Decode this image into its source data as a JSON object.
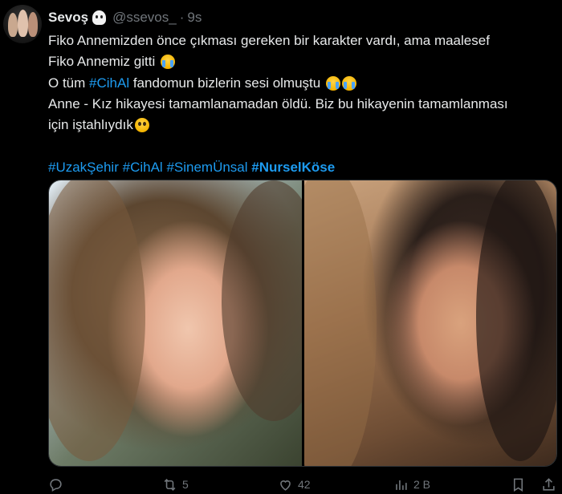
{
  "author": {
    "display_name": "Sevoş",
    "handle": "@ssevos_",
    "separator": "·",
    "time": "9s",
    "avatar_icon": "avatar",
    "badge_icon": "ghost-emoji-icon"
  },
  "tweet": {
    "lines": [
      {
        "a": "Fiko Annemizden önce çıkması gereken bir karakter vardı,  ama maalesef"
      },
      {
        "a": "Fiko Annemiz gitti",
        "emoji": "loudly-crying-face-icon"
      },
      {
        "a": "O tüm ",
        "tag": "#CihAl",
        "b": " fandomun bizlerin sesi olmuştu",
        "emoji": "loudly-crying-face-icon"
      },
      {
        "a": "Anne - Kız hikayesi tamamlanamadan öldü. Biz bu hikayenin tamamlanması"
      },
      {
        "a": "için iştahlıydık",
        "emoji": "pleading-face-icon"
      }
    ],
    "line1": "Fiko Annemizden önce çıkması gereken bir karakter vardı,  ama maalesef",
    "line2": "Fiko Annemiz gitti",
    "line3_pre": "O tüm ",
    "line3_tag": "#CihAl",
    "line3_post": " fandomun bizlerin sesi olmuştu",
    "line4": "Anne - Kız hikayesi tamamlanamadan öldü. Biz bu hikayenin tamamlanması",
    "line5": "için iştahlıydık",
    "hashtags": [
      "#UzakŞehir",
      "#CihAl",
      "#SinemÜnsal",
      "#NurselKöse"
    ]
  },
  "media": [
    {
      "name": "photo-young-woman-crying"
    },
    {
      "name": "photo-older-woman-injured"
    }
  ],
  "actions": {
    "reply": {
      "icon": "reply-icon",
      "count": ""
    },
    "retweet": {
      "icon": "retweet-icon",
      "count": "5"
    },
    "like": {
      "icon": "heart-icon",
      "count": "42"
    },
    "views": {
      "icon": "views-chart-icon",
      "count": "2 B"
    },
    "bookmark": {
      "icon": "bookmark-icon",
      "count": ""
    },
    "share": {
      "icon": "share-icon",
      "count": ""
    }
  },
  "colors": {
    "background": "#000000",
    "text": "#e7e9ea",
    "muted": "#71767b",
    "link": "#1d9bf0"
  }
}
